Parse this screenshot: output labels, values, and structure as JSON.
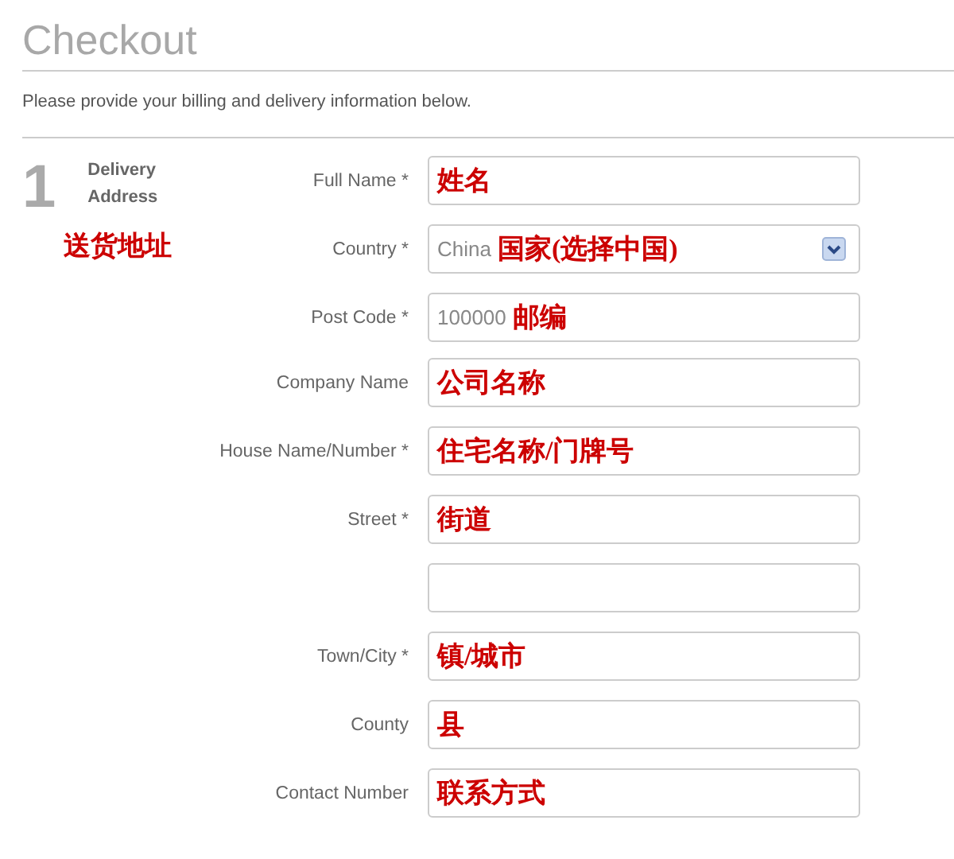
{
  "page": {
    "title": "Checkout",
    "intro": "Please provide your billing and delivery information below."
  },
  "step": {
    "number": "1",
    "title": "Delivery Address",
    "note": "送货地址"
  },
  "groups": [
    {
      "fields": [
        {
          "kind": "text",
          "label": "Full Name *",
          "note": "姓名"
        },
        {
          "kind": "select",
          "label": "Country *",
          "value": "China",
          "note": "国家(选择中国)"
        },
        {
          "kind": "text",
          "label": "Post Code *",
          "value": "100000",
          "note": "邮编"
        }
      ]
    },
    {
      "fields": [
        {
          "kind": "text",
          "label": "Company Name",
          "note": "公司名称"
        },
        {
          "kind": "text",
          "label": "House Name/Number *",
          "note": "住宅名称/门牌号"
        },
        {
          "kind": "text",
          "label": "Street *",
          "note": "街道"
        },
        {
          "kind": "text"
        },
        {
          "kind": "text",
          "label": "Town/City *",
          "note": "镇/城市"
        },
        {
          "kind": "text",
          "label": "County",
          "note": "县"
        },
        {
          "kind": "text",
          "label": "Contact Number",
          "note": "联系方式"
        }
      ]
    }
  ]
}
